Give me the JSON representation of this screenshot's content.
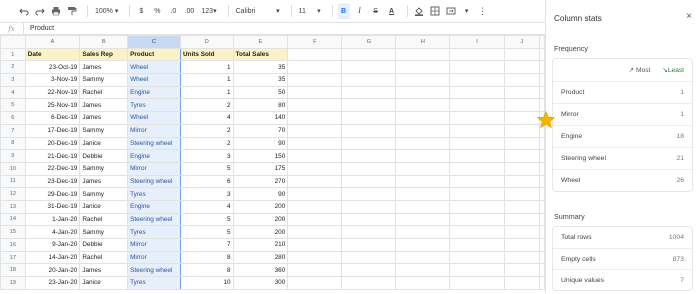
{
  "toolbar": {
    "zoom": "100%",
    "currency": "$",
    "percent": "%",
    "dec_decrease": ".0",
    "dec_increase": ".00",
    "format_more": "123",
    "font": "Calibri",
    "size": "11",
    "bold": "B",
    "italic": "I",
    "strike": "S",
    "text_color": "A"
  },
  "formula": {
    "fx": "fx",
    "value": "Product"
  },
  "grid": {
    "col_headers": [
      "A",
      "B",
      "C",
      "D",
      "E",
      "F",
      "G",
      "H",
      "I",
      "J"
    ],
    "header_row": [
      "Date",
      "Sales Rep",
      "Product",
      "Units Sold",
      "Total Sales"
    ],
    "rows": [
      {
        "n": "2",
        "date": "23-Oct-19",
        "rep": "James",
        "product": "Wheel",
        "units": "1",
        "total": "35"
      },
      {
        "n": "3",
        "date": "3-Nov-19",
        "rep": "Sammy",
        "product": "Wheel",
        "units": "1",
        "total": "35"
      },
      {
        "n": "4",
        "date": "22-Nov-19",
        "rep": "Rachel",
        "product": "Engine",
        "units": "1",
        "total": "50"
      },
      {
        "n": "5",
        "date": "25-Nov-19",
        "rep": "James",
        "product": "Tyres",
        "units": "2",
        "total": "80"
      },
      {
        "n": "6",
        "date": "6-Dec-19",
        "rep": "James",
        "product": "Wheel",
        "units": "4",
        "total": "140"
      },
      {
        "n": "7",
        "date": "17-Dec-19",
        "rep": "Sammy",
        "product": "Mirror",
        "units": "2",
        "total": "70"
      },
      {
        "n": "8",
        "date": "20-Dec-19",
        "rep": "Janice",
        "product": "Steering wheel",
        "units": "2",
        "total": "90"
      },
      {
        "n": "9",
        "date": "21-Dec-19",
        "rep": "Debbie",
        "product": "Engine",
        "units": "3",
        "total": "150"
      },
      {
        "n": "10",
        "date": "22-Dec-19",
        "rep": "Sammy",
        "product": "Mirror",
        "units": "5",
        "total": "175"
      },
      {
        "n": "11",
        "date": "23-Dec-19",
        "rep": "James",
        "product": "Steering wheel",
        "units": "6",
        "total": "270"
      },
      {
        "n": "12",
        "date": "29-Dec-19",
        "rep": "Sammy",
        "product": "Tyres",
        "units": "3",
        "total": "90"
      },
      {
        "n": "13",
        "date": "31-Dec-19",
        "rep": "Janice",
        "product": "Engine",
        "units": "4",
        "total": "200"
      },
      {
        "n": "14",
        "date": "1-Jan-20",
        "rep": "Rachel",
        "product": "Steering wheel",
        "units": "5",
        "total": "200"
      },
      {
        "n": "15",
        "date": "4-Jan-20",
        "rep": "Sammy",
        "product": "Tyres",
        "units": "5",
        "total": "200"
      },
      {
        "n": "16",
        "date": "9-Jan-20",
        "rep": "Debbie",
        "product": "Mirror",
        "units": "7",
        "total": "210"
      },
      {
        "n": "17",
        "date": "14-Jan-20",
        "rep": "Rachel",
        "product": "Mirror",
        "units": "8",
        "total": "280"
      },
      {
        "n": "18",
        "date": "20-Jan-20",
        "rep": "James",
        "product": "Steering wheel",
        "units": "8",
        "total": "360"
      },
      {
        "n": "19",
        "date": "23-Jan-20",
        "rep": "Janice",
        "product": "Tyres",
        "units": "10",
        "total": "300"
      }
    ]
  },
  "panel": {
    "title": "Column stats",
    "close": "×",
    "frequency_label": "Frequency",
    "sort_most": "Most",
    "sort_least": "Least",
    "frequency": [
      {
        "label": "Product",
        "value": "1"
      },
      {
        "label": "Mirror",
        "value": "1"
      },
      {
        "label": "Engine",
        "value": "18"
      },
      {
        "label": "Steering wheel",
        "value": "21"
      },
      {
        "label": "Wheel",
        "value": "26"
      }
    ],
    "summary_label": "Summary",
    "summary": [
      {
        "label": "Total rows",
        "value": "1004"
      },
      {
        "label": "Empty cells",
        "value": "873"
      },
      {
        "label": "Unique values",
        "value": "7"
      }
    ]
  },
  "colors": {
    "selection": "#e7effb",
    "header_fill": "#fbf3c8",
    "accent": "#1a73e8",
    "star": "#f4b400"
  }
}
